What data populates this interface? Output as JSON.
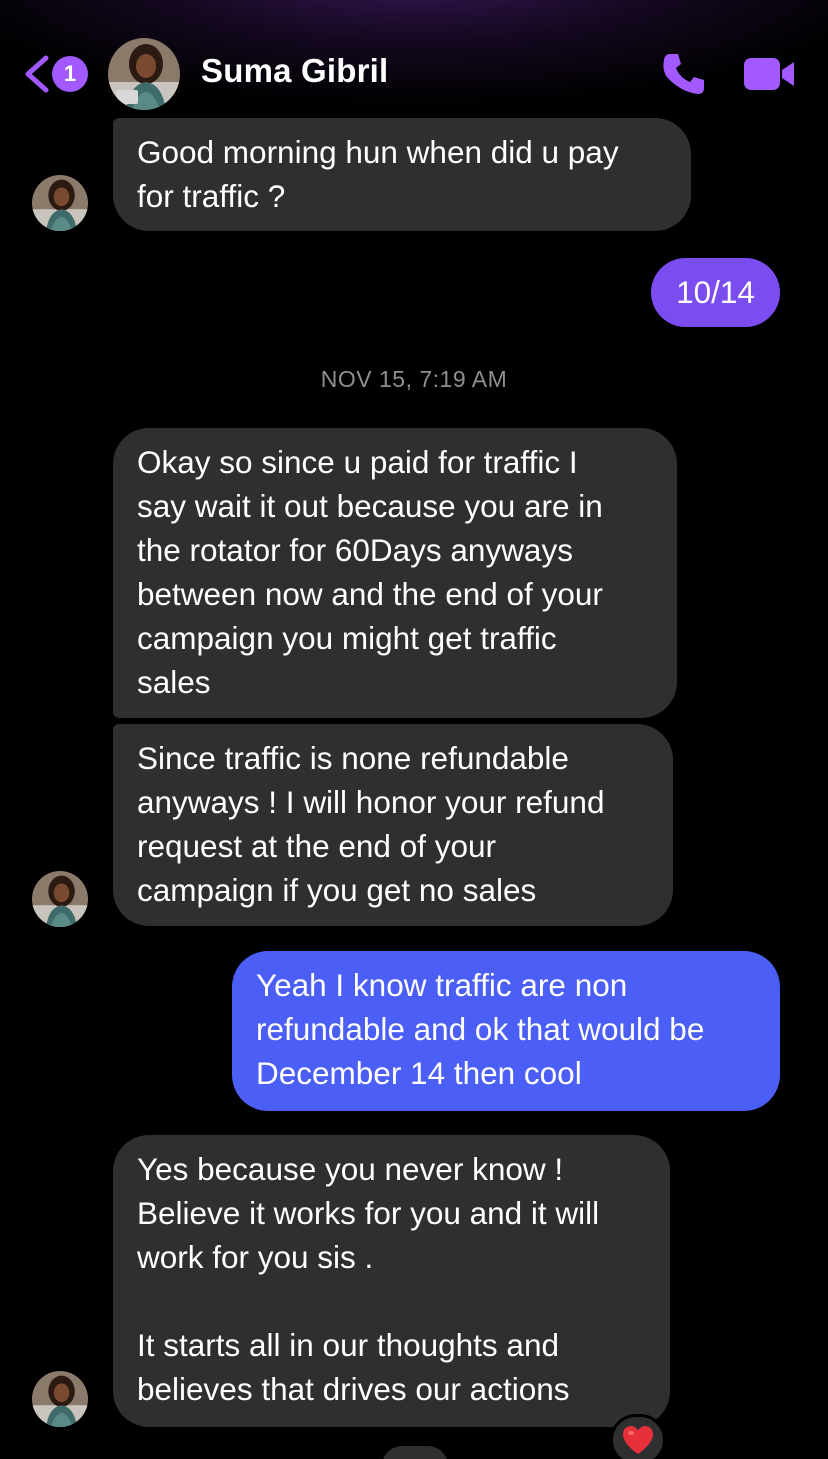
{
  "header": {
    "unread_count": "1",
    "contact_name": "Suma Gibril",
    "icons": {
      "back": "chevron-left-icon",
      "call": "phone-icon",
      "video": "video-camera-icon"
    },
    "accent_color": "#a259ff"
  },
  "messages": [
    {
      "direction": "incoming",
      "text": "Good morning hun when did u pay\nfor traffic ?"
    },
    {
      "direction": "outgoing",
      "text": "10/14"
    },
    {
      "direction": "incoming",
      "text": "Okay so since u paid for traffic I\nsay wait it out because you are in\nthe rotator for 60Days anyways\nbetween now and the end of your\ncampaign you might get traffic\nsales"
    },
    {
      "direction": "incoming",
      "text": "Since traffic is none refundable\nanyways ! I will honor your refund\nrequest at the end of your\ncampaign if you get no sales"
    },
    {
      "direction": "outgoing",
      "text": "Yeah I know traffic are non\nrefundable and ok that would be\nDecember 14 then cool"
    },
    {
      "direction": "incoming",
      "text": "Yes because you never know !\nBelieve it works for you and it will\nwork for you sis .\n\nIt starts all in our thoughts and\nbelieves that drives our actions",
      "reaction": "heart-emoji"
    }
  ],
  "timestamp_divider": "NOV 15, 7:19 AM",
  "colors": {
    "incoming_bubble": "#2f2f31",
    "outgoing_bubble_1": "#7b4cf0",
    "outgoing_bubble_2": "#4b5ef6",
    "background": "#000000"
  }
}
